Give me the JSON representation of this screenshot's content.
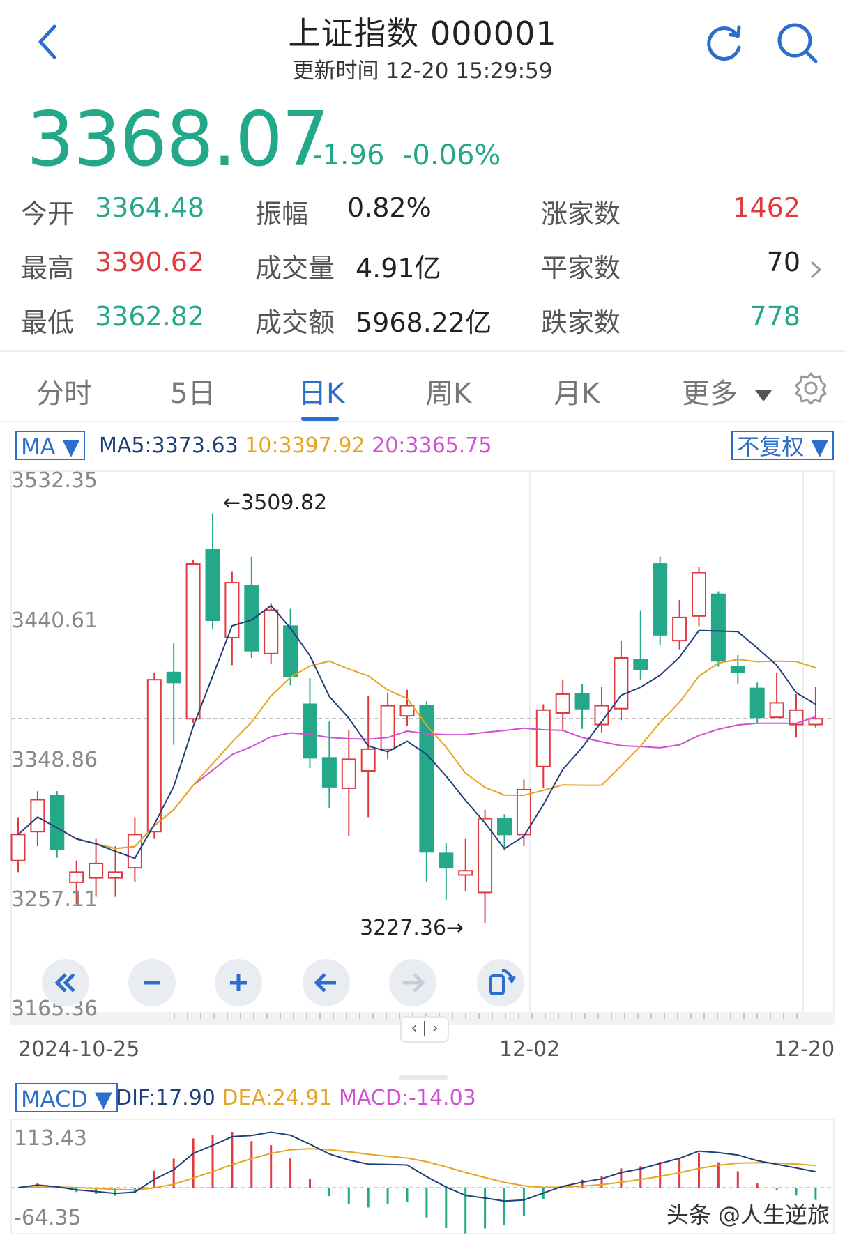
{
  "header": {
    "title": "上证指数 000001",
    "update_label": "更新时间",
    "update_time": "12-20 15:29:59",
    "back_icon": "chevron-left-icon",
    "refresh_icon": "refresh-icon",
    "search_icon": "search-icon"
  },
  "quote": {
    "price": "3368.07",
    "change": "-1.96",
    "change_pct": "-0.06%"
  },
  "stats": {
    "open_label": "今开",
    "open": "3364.48",
    "high_label": "最高",
    "high": "3390.62",
    "low_label": "最低",
    "low": "3362.82",
    "amp_label": "振幅",
    "amp": "0.82%",
    "vol_label": "成交量",
    "vol": "4.91亿",
    "amount_label": "成交额",
    "amount": "5968.22亿",
    "up_label": "涨家数",
    "up": "1462",
    "flat_label": "平家数",
    "flat": "70",
    "down_label": "跌家数",
    "down": "778"
  },
  "tabs": [
    "分时",
    "5日",
    "日K",
    "周K",
    "月K",
    "更多"
  ],
  "active_tab": "日K",
  "ma_bar": {
    "selector": "MA",
    "ma5": "MA5:3373.63",
    "ma10": "10:3397.92",
    "ma20": "20:3365.75",
    "adjust": "不复权"
  },
  "price_axis": [
    "3532.35",
    "3440.61",
    "3348.86",
    "3257.11",
    "3165.36"
  ],
  "annotations": {
    "high_mark": "←3509.82",
    "low_mark": "3227.36→"
  },
  "date_axis": [
    "2024-10-25",
    "12-02",
    "12-20"
  ],
  "macd_bar": {
    "selector": "MACD",
    "dif": "DIF:17.90",
    "dea": "DEA:24.91",
    "macd": "MACD:-14.03"
  },
  "macd_axis": [
    "113.43",
    "-64.35"
  ],
  "watermark": "头条 @人生逆旅",
  "colors": {
    "up": "#e0393e",
    "down": "#23a889",
    "accent": "#2d6dcc",
    "ma5": "#1f3f7a",
    "ma10": "#e5a51e",
    "ma20": "#d14fd3"
  },
  "chart_data": {
    "type": "candlestick",
    "ylim": [
      3165.36,
      3532.35
    ],
    "candles": [
      {
        "o": 3270,
        "c": 3288,
        "h": 3300,
        "l": 3262
      },
      {
        "o": 3290,
        "c": 3312,
        "h": 3318,
        "l": 3280
      },
      {
        "o": 3315,
        "c": 3278,
        "h": 3318,
        "l": 3272
      },
      {
        "o": 3255,
        "c": 3262,
        "h": 3270,
        "l": 3240
      },
      {
        "o": 3258,
        "c": 3268,
        "h": 3285,
        "l": 3245
      },
      {
        "o": 3258,
        "c": 3262,
        "h": 3280,
        "l": 3245
      },
      {
        "o": 3265,
        "c": 3288,
        "h": 3300,
        "l": 3255
      },
      {
        "o": 3290,
        "c": 3395,
        "h": 3400,
        "l": 3285
      },
      {
        "o": 3400,
        "c": 3393,
        "h": 3420,
        "l": 3350
      },
      {
        "o": 3368,
        "c": 3475,
        "h": 3478,
        "l": 3365
      },
      {
        "o": 3485,
        "c": 3436,
        "h": 3510,
        "l": 3430
      },
      {
        "o": 3424,
        "c": 3462,
        "h": 3470,
        "l": 3405
      },
      {
        "o": 3460,
        "c": 3415,
        "h": 3480,
        "l": 3410
      },
      {
        "o": 3413,
        "c": 3443,
        "h": 3448,
        "l": 3406
      },
      {
        "o": 3432,
        "c": 3397,
        "h": 3444,
        "l": 3391
      },
      {
        "o": 3378,
        "c": 3341,
        "h": 3396,
        "l": 3334
      },
      {
        "o": 3341,
        "c": 3321,
        "h": 3366,
        "l": 3306
      },
      {
        "o": 3320,
        "c": 3340,
        "h": 3360,
        "l": 3287
      },
      {
        "o": 3332,
        "c": 3347,
        "h": 3384,
        "l": 3300
      },
      {
        "o": 3347,
        "c": 3377,
        "h": 3386,
        "l": 3340
      },
      {
        "o": 3370,
        "c": 3377,
        "h": 3388,
        "l": 3363
      },
      {
        "o": 3377,
        "c": 3276,
        "h": 3380,
        "l": 3255
      },
      {
        "o": 3275,
        "c": 3265,
        "h": 3282,
        "l": 3243
      },
      {
        "o": 3260,
        "c": 3263,
        "h": 3285,
        "l": 3249
      },
      {
        "o": 3248,
        "c": 3299,
        "h": 3305,
        "l": 3227
      },
      {
        "o": 3299,
        "c": 3288,
        "h": 3302,
        "l": 3277
      },
      {
        "o": 3288,
        "c": 3319,
        "h": 3326,
        "l": 3280
      },
      {
        "o": 3335,
        "c": 3374,
        "h": 3378,
        "l": 3320
      },
      {
        "o": 3372,
        "c": 3385,
        "h": 3395,
        "l": 3360
      },
      {
        "o": 3385,
        "c": 3375,
        "h": 3392,
        "l": 3361
      },
      {
        "o": 3364,
        "c": 3377,
        "h": 3390,
        "l": 3358
      },
      {
        "o": 3375,
        "c": 3410,
        "h": 3422,
        "l": 3367
      },
      {
        "o": 3409,
        "c": 3402,
        "h": 3443,
        "l": 3395
      },
      {
        "o": 3475,
        "c": 3426,
        "h": 3480,
        "l": 3419
      },
      {
        "o": 3422,
        "c": 3438,
        "h": 3450,
        "l": 3416
      },
      {
        "o": 3439,
        "c": 3469,
        "h": 3473,
        "l": 3432
      },
      {
        "o": 3454,
        "c": 3408,
        "h": 3456,
        "l": 3404
      },
      {
        "o": 3404,
        "c": 3400,
        "h": 3412,
        "l": 3392
      },
      {
        "o": 3389,
        "c": 3369,
        "h": 3393,
        "l": 3365
      },
      {
        "o": 3369,
        "c": 3379,
        "h": 3400,
        "l": 3369
      },
      {
        "o": 3364,
        "c": 3374,
        "h": 3385,
        "l": 3355
      },
      {
        "o": 3364,
        "c": 3368,
        "h": 3390,
        "l": 3362
      }
    ]
  }
}
